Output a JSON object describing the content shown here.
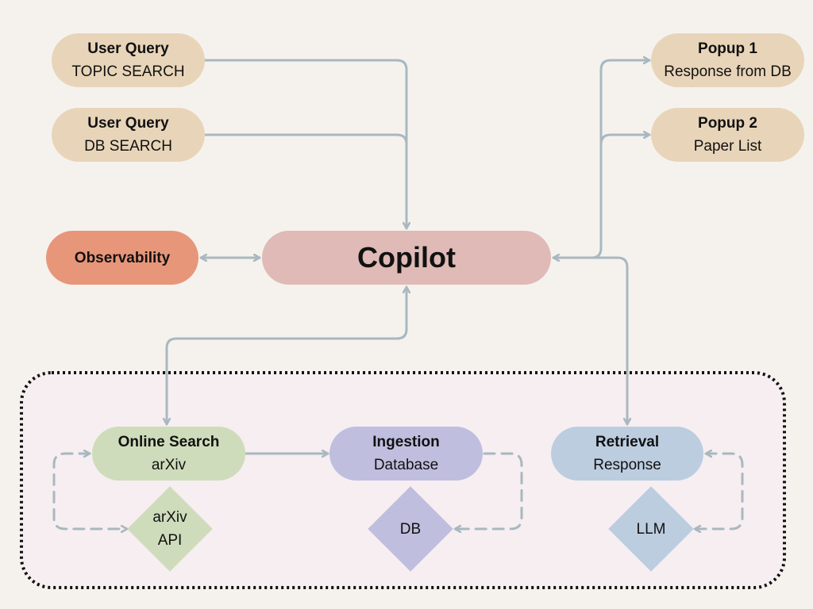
{
  "nodes": {
    "user_query_topic": {
      "title": "User Query",
      "subtitle": "TOPIC SEARCH"
    },
    "user_query_db": {
      "title": "User Query",
      "subtitle": "DB SEARCH"
    },
    "popup1": {
      "title": "Popup 1",
      "subtitle": "Response from DB"
    },
    "popup2": {
      "title": "Popup 2",
      "subtitle": "Paper List"
    },
    "observability": {
      "title": "Observability"
    },
    "copilot": {
      "title": "Copilot"
    },
    "online_search": {
      "title": "Online Search",
      "subtitle": "arXiv"
    },
    "ingestion": {
      "title": "Ingestion",
      "subtitle": "Database"
    },
    "retrieval": {
      "title": "Retrieval",
      "subtitle": "Response"
    },
    "arxiv_api": {
      "line1": "arXiv",
      "line2": "API"
    },
    "db": {
      "line1": "DB"
    },
    "llm": {
      "line1": "LLM"
    }
  },
  "colors": {
    "background": "#f5f2ee",
    "user_query": "#e8d5b9",
    "observability": "#e8967a",
    "copilot": "#dfbab6",
    "online_search": "#cfdcbb",
    "ingestion": "#c0bedf",
    "retrieval": "#bccde0",
    "edge": "#a9b8c0",
    "group_fill": "#f6eef0"
  }
}
